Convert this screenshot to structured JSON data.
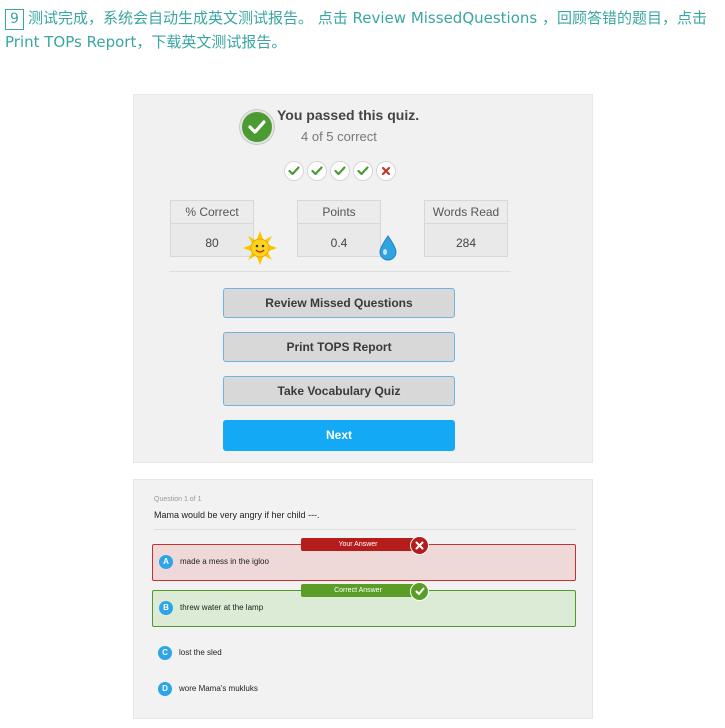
{
  "instruction": {
    "step_number": "9",
    "text": "测试完成，系统会自动生成英文测试报告。 点击 Review MissedQuestions ，回顾答错的题目，点击 Print TOPs Report，下载英文测试报告。"
  },
  "result": {
    "title": "You passed this quiz.",
    "score_text": "4 of 5 correct",
    "answers": [
      "correct",
      "correct",
      "correct",
      "correct",
      "incorrect"
    ],
    "stats": [
      {
        "label": "% Correct",
        "value": "80"
      },
      {
        "label": "Points",
        "value": "0.4"
      },
      {
        "label": "Words Read",
        "value": "284"
      }
    ],
    "buttons": {
      "review": "Review Missed Questions",
      "print": "Print TOPS Report",
      "vocab": "Take Vocabulary Quiz",
      "next": "Next"
    },
    "colors": {
      "accent": "#14a9f4",
      "correct": "#4b9a32",
      "incorrect": "#c0392b"
    }
  },
  "question": {
    "counter": "Question 1 of 1",
    "text": "Mama would be very angry if her child ---.",
    "your_answer_label": "Your Answer",
    "correct_answer_label": "Correct Answer",
    "options": [
      {
        "letter": "A",
        "text": "made a mess in the igloo"
      },
      {
        "letter": "B",
        "text": "threw water at the lamp"
      },
      {
        "letter": "C",
        "text": "lost the sled"
      },
      {
        "letter": "D",
        "text": "wore Mama's mukluks"
      }
    ]
  }
}
